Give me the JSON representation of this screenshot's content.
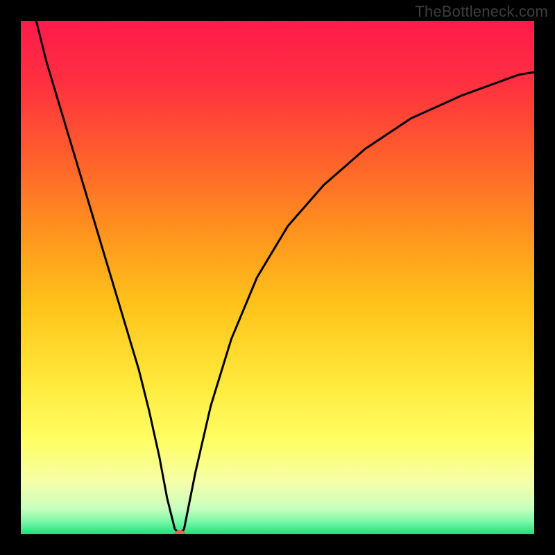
{
  "watermark": "TheBottleneck.com",
  "chart_data": {
    "type": "line",
    "title": "",
    "xlabel": "",
    "ylabel": "",
    "xlim": [
      0,
      100
    ],
    "ylim": [
      0,
      100
    ],
    "grid": false,
    "legend": false,
    "background_gradient_stops": [
      {
        "offset": 0.0,
        "color": "#ff1a4b"
      },
      {
        "offset": 0.12,
        "color": "#ff3040"
      },
      {
        "offset": 0.25,
        "color": "#ff5a2e"
      },
      {
        "offset": 0.4,
        "color": "#ff8f1e"
      },
      {
        "offset": 0.55,
        "color": "#ffc21a"
      },
      {
        "offset": 0.7,
        "color": "#ffe83a"
      },
      {
        "offset": 0.82,
        "color": "#ffff66"
      },
      {
        "offset": 0.9,
        "color": "#f4ffaa"
      },
      {
        "offset": 0.95,
        "color": "#c8ffbe"
      },
      {
        "offset": 0.975,
        "color": "#7cf7a8"
      },
      {
        "offset": 1.0,
        "color": "#1fe07a"
      }
    ],
    "series": [
      {
        "name": "bottleneck-curve",
        "color": "#000000",
        "stroke_width": 3,
        "x": [
          3,
          5,
          8,
          11,
          14,
          17,
          20,
          23,
          25,
          27,
          28.5,
          30,
          31,
          31.8,
          34,
          37,
          41,
          46,
          52,
          59,
          67,
          76,
          86,
          97,
          100
        ],
        "values": [
          100,
          92,
          82,
          72,
          62,
          52,
          42,
          32,
          24,
          15,
          7,
          1,
          0,
          1,
          12,
          25,
          38,
          50,
          60,
          68,
          75,
          81,
          85.5,
          89.5,
          90
        ]
      }
    ],
    "marker": {
      "x": 31,
      "y": 0,
      "rx": 8,
      "ry": 6,
      "color": "#d96b50"
    }
  }
}
